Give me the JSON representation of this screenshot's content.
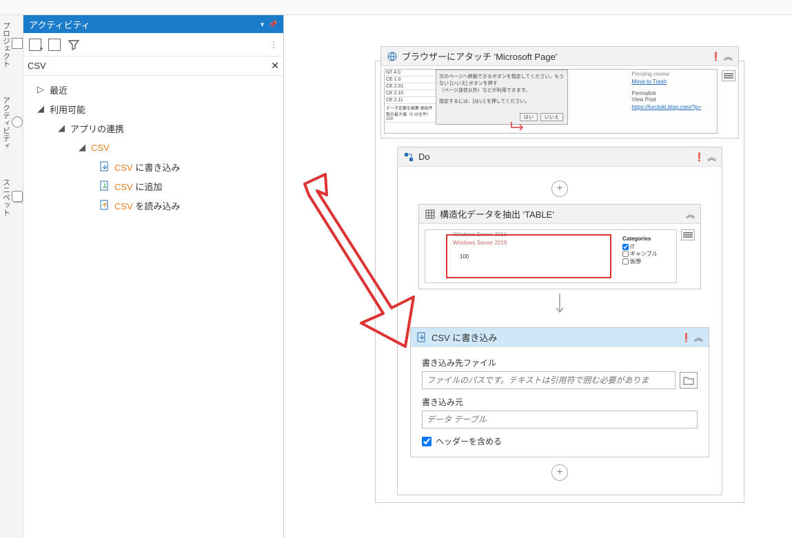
{
  "rail": {
    "items": [
      {
        "name": "project",
        "label": "プロジェクト"
      },
      {
        "name": "activity",
        "label": "アクティビティ"
      },
      {
        "name": "snippet",
        "label": "スニペット"
      }
    ]
  },
  "panel": {
    "title": "アクティビティ",
    "search_value": "CSV",
    "tree": {
      "recent": "最近",
      "available": "利用可能",
      "app_integration": "アプリの連携",
      "csv": "CSV",
      "items": [
        {
          "plain": "CSV",
          "rest": " に書き込み"
        },
        {
          "plain": "CSV",
          "rest": " に追加"
        },
        {
          "plain": "CSV",
          "rest": " を読み込み"
        }
      ]
    }
  },
  "designer": {
    "browser_attach": "ブラウザーにアタッチ 'Microsoft Page'",
    "do_label": "Do",
    "extract_label": "構造化データを抽出 'TABLE'",
    "csv_write": {
      "title": "CSV に書き込み",
      "file_label": "書き込み先ファイル",
      "file_placeholder": "ファイルのパスです。テキストは引用符で囲む必要がありま",
      "src_label": "書き込み元",
      "src_placeholder": "データ テーブル",
      "include_header": "ヘッダーを含める"
    },
    "thumb": {
      "rows": [
        "NT 4.0",
        "CE 1.0",
        "CE 2.01",
        "CE 2.10",
        "CE 2.11"
      ],
      "dlg_text1": "次のページへ移動できるボタンを指定してください。もうない [いいえ] ボタンを押す",
      "dlg_text2": "（ページ送信以外）などが利用できます。",
      "dlg_text3": "指定するには、[はい] を押してください。",
      "dlg_yes": "はい",
      "dlg_no": "いいえ",
      "right_pending": "Pending review",
      "right_trash": "Move to Trash",
      "right_permalink": "Permalink",
      "right_view": "View Post",
      "right_url": "https://furutuki.blog.com/?p=",
      "footer": "データ定義を編集     抽出件数の最大値（0 は全件）   100"
    },
    "extract_thumb": {
      "ws1": "Windows Server 2016",
      "ws2": "Windows Server 2019",
      "num": "100",
      "cat": "Categories",
      "c1": "IT",
      "c2": "ギャンブル",
      "c3": "仮想"
    }
  }
}
